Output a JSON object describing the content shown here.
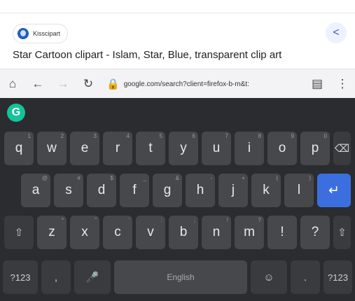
{
  "source": {
    "name": "Kisscipart"
  },
  "page": {
    "title": "Star Cartoon clipart - Islam, Star, Blue, transparent clip art"
  },
  "toolbar": {
    "url": "google.com/search?client=firefox-b-m&t:"
  },
  "keyboard": {
    "row1": [
      {
        "label": "q",
        "hint": "1"
      },
      {
        "label": "w",
        "hint": "2"
      },
      {
        "label": "e",
        "hint": "3"
      },
      {
        "label": "r",
        "hint": "4"
      },
      {
        "label": "t",
        "hint": "5"
      },
      {
        "label": "y",
        "hint": "6"
      },
      {
        "label": "u",
        "hint": "7"
      },
      {
        "label": "i",
        "hint": "8"
      },
      {
        "label": "o",
        "hint": "9"
      },
      {
        "label": "p",
        "hint": "0"
      }
    ],
    "row2": [
      {
        "label": "a",
        "hint": "@"
      },
      {
        "label": "s",
        "hint": "#"
      },
      {
        "label": "d",
        "hint": "$"
      },
      {
        "label": "f",
        "hint": "_"
      },
      {
        "label": "g",
        "hint": "&"
      },
      {
        "label": "h",
        "hint": "-"
      },
      {
        "label": "j",
        "hint": "+"
      },
      {
        "label": "k",
        "hint": "("
      },
      {
        "label": "l",
        "hint": ")"
      }
    ],
    "row3": [
      {
        "label": "z",
        "hint": "*"
      },
      {
        "label": "x",
        "hint": "\""
      },
      {
        "label": "c",
        "hint": "'"
      },
      {
        "label": "v",
        "hint": ":"
      },
      {
        "label": "b",
        "hint": ";"
      },
      {
        "label": "n",
        "hint": "!"
      },
      {
        "label": "m",
        "hint": "?"
      },
      {
        "label": "!",
        "hint": ""
      },
      {
        "label": "?",
        "hint": ""
      }
    ],
    "symbols_left": "?123",
    "comma": ",",
    "space": "English",
    "period": ".",
    "symbols_right": "?123",
    "enter_color": "#3b6fe0"
  }
}
